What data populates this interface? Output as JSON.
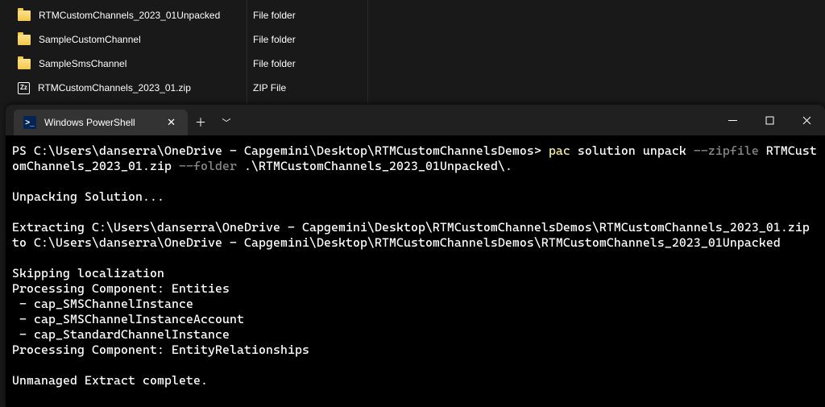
{
  "explorer": {
    "rows": [
      {
        "name": "RTMCustomChannels_2023_01Unpacked",
        "type": "File folder",
        "icon": "folder"
      },
      {
        "name": "SampleCustomChannel",
        "type": "File folder",
        "icon": "folder"
      },
      {
        "name": "SampleSmsChannel",
        "type": "File folder",
        "icon": "folder"
      },
      {
        "name": "RTMCustomChannels_2023_01.zip",
        "type": "ZIP File",
        "icon": "zip"
      }
    ],
    "zip_badge": "Zz"
  },
  "terminal": {
    "tab_title": "Windows PowerShell",
    "prompt_prefix": "PS ",
    "prompt_path": "C:\\Users\\danserra\\OneDrive - Capgemini\\Desktop\\RTMCustomChannelsDemos",
    "cmd_name": "pac",
    "cmd_args1": " solution unpack ",
    "cmd_flag1": "--zipfile",
    "cmd_args2": " RTMCustomChannels_2023_01.zip ",
    "cmd_flag2": "--folder",
    "cmd_args3": " .\\RTMCustomChannels_2023_01Unpacked\\.",
    "out_unpacking": "Unpacking Solution...",
    "out_extracting": "Extracting C:\\Users\\danserra\\OneDrive - Capgemini\\Desktop\\RTMCustomChannelsDemos\\RTMCustomChannels_2023_01.zip to C:\\Users\\danserra\\OneDrive - Capgemini\\Desktop\\RTMCustomChannelsDemos\\RTMCustomChannels_2023_01Unpacked",
    "out_skip": "Skipping localization",
    "out_proc_entities_header": "Processing Component: Entities",
    "out_entities": [
      "cap_SMSChannelInstance",
      "cap_SMSChannelInstanceAccount",
      "cap_StandardChannelInstance"
    ],
    "out_proc_rel": "Processing Component: EntityRelationships",
    "out_complete": "Unmanaged Extract complete."
  }
}
